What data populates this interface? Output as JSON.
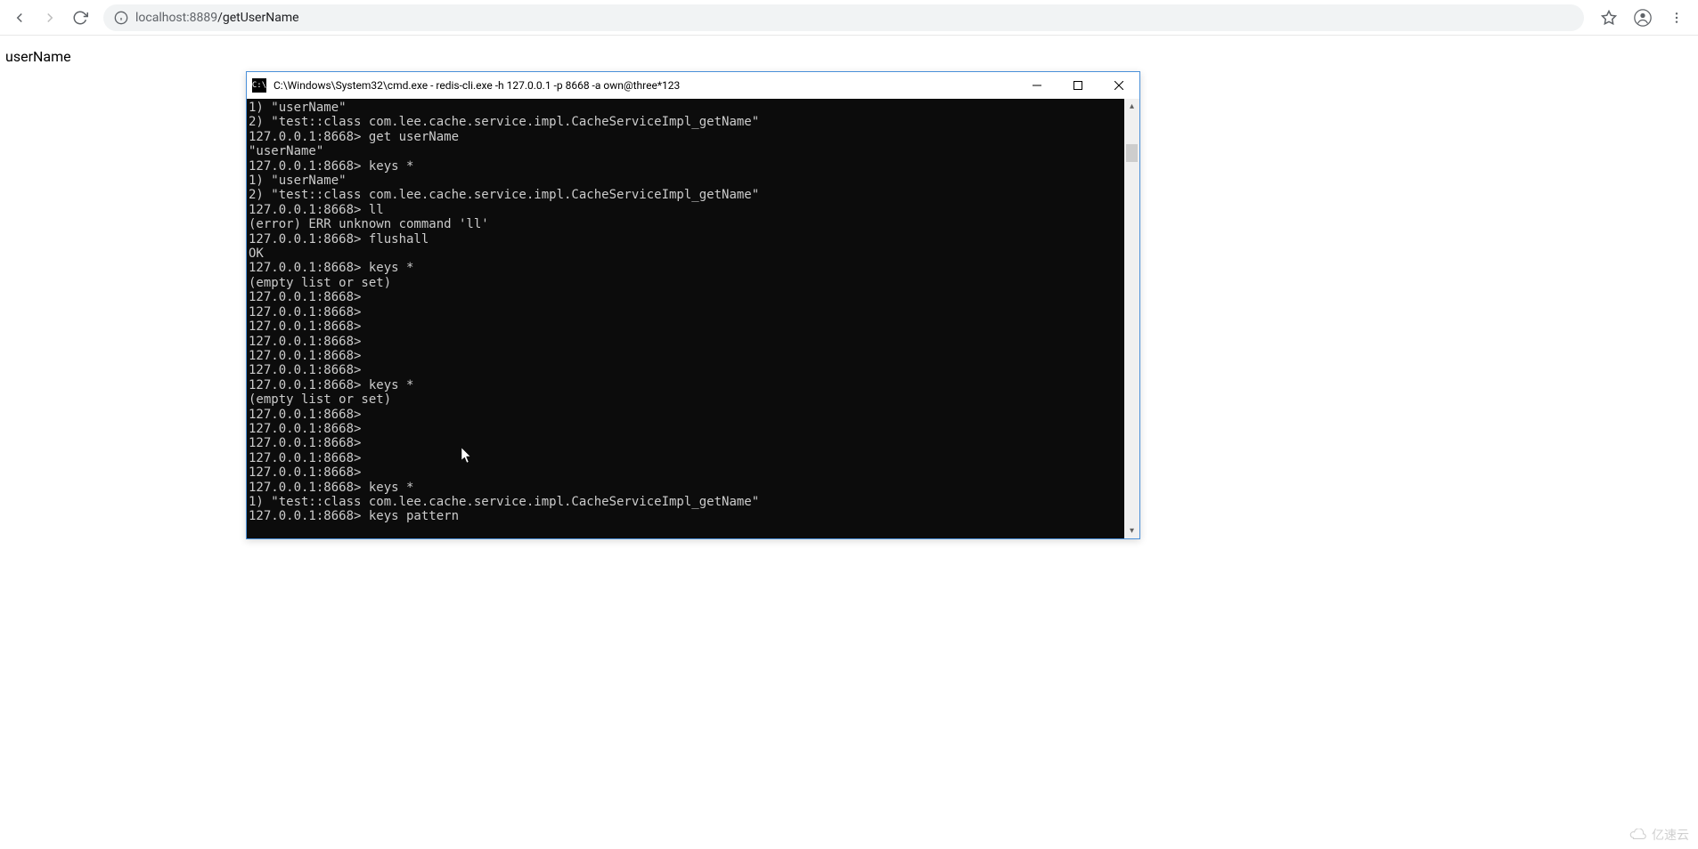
{
  "browser": {
    "url_host": "localhost:8889",
    "url_path": "/getUserName"
  },
  "page": {
    "body_text": "userName"
  },
  "cmd": {
    "icon_label": "C:\\",
    "title": "C:\\Windows\\System32\\cmd.exe - redis-cli.exe  -h 127.0.0.1 -p 8668 -a own@three*123",
    "lines": [
      "1) \"userName\"",
      "2) \"test::class com.lee.cache.service.impl.CacheServiceImpl_getName\"",
      "127.0.0.1:8668> get userName",
      "\"userName\"",
      "127.0.0.1:8668> keys *",
      "1) \"userName\"",
      "2) \"test::class com.lee.cache.service.impl.CacheServiceImpl_getName\"",
      "127.0.0.1:8668> ll",
      "(error) ERR unknown command 'll'",
      "127.0.0.1:8668> flushall",
      "OK",
      "127.0.0.1:8668> keys *",
      "(empty list or set)",
      "127.0.0.1:8668>",
      "127.0.0.1:8668>",
      "127.0.0.1:8668>",
      "127.0.0.1:8668>",
      "127.0.0.1:8668>",
      "127.0.0.1:8668>",
      "127.0.0.1:8668> keys *",
      "(empty list or set)",
      "127.0.0.1:8668>",
      "127.0.0.1:8668>",
      "127.0.0.1:8668>",
      "127.0.0.1:8668>",
      "127.0.0.1:8668>",
      "127.0.0.1:8668> keys *",
      "1) \"test::class com.lee.cache.service.impl.CacheServiceImpl_getName\"",
      "127.0.0.1:8668> keys pattern"
    ]
  },
  "watermark": {
    "text": "亿速云"
  }
}
